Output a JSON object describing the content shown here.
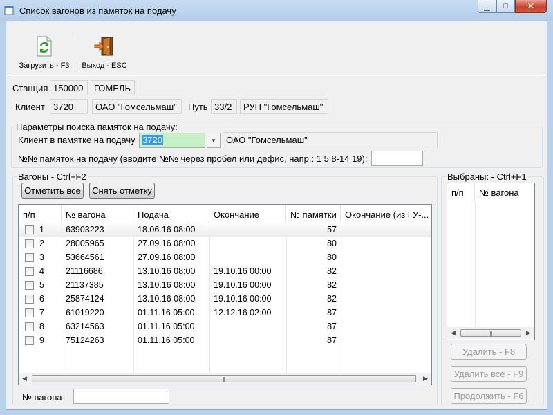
{
  "window": {
    "title": "Список вагонов из памяток на подачу",
    "min_glyph": "▁",
    "max_glyph": "□",
    "close_glyph": "✕"
  },
  "toolbar": {
    "load_label": "Загрузить - F3",
    "exit_label": "Выход - ESC"
  },
  "station": {
    "label": "Станция",
    "code": "150000",
    "name": "ГОМЕЛЬ"
  },
  "client": {
    "label": "Клиент",
    "code": "3720",
    "name": "ОАО \"Гомсельмаш\"",
    "track_label": "Путь",
    "track": "33/2",
    "track_owner": "РУП \"Гомсельмаш\""
  },
  "search": {
    "group_title": "Параметры поиска памяток на подачу:",
    "client_label": "Клиент в памятке на подачу",
    "client_value": "3720",
    "client_name": "ОАО \"Гомсельмаш\"",
    "memo_label": "№№ памяток на подачу (вводите №№ через пробел или дефис, напр.: 1 5 8-14 19):",
    "memo_value": ""
  },
  "wagons": {
    "group_title": "Вагоны - Ctrl+F2",
    "check_all": "Отметить все",
    "uncheck": "Снять отметку",
    "columns": [
      "п/п",
      "№ вагона",
      "Подача",
      "Окончание",
      "№ памятки",
      "Окончание (из ГУ-..."
    ],
    "rows": [
      {
        "n": "1",
        "wagon": "63903223",
        "supply": "18.06.16 08:00",
        "end": "",
        "memo": "57",
        "end_gu": ""
      },
      {
        "n": "2",
        "wagon": "28005965",
        "supply": "27.09.16 08:00",
        "end": "",
        "memo": "80",
        "end_gu": ""
      },
      {
        "n": "3",
        "wagon": "53664561",
        "supply": "27.09.16 08:00",
        "end": "",
        "memo": "80",
        "end_gu": ""
      },
      {
        "n": "4",
        "wagon": "21116686",
        "supply": "13.10.16 08:00",
        "end": "19.10.16 00:00",
        "memo": "82",
        "end_gu": ""
      },
      {
        "n": "5",
        "wagon": "21137385",
        "supply": "13.10.16 08:00",
        "end": "19.10.16 00:00",
        "memo": "82",
        "end_gu": ""
      },
      {
        "n": "6",
        "wagon": "25874124",
        "supply": "13.10.16 08:00",
        "end": "19.10.16 00:00",
        "memo": "82",
        "end_gu": ""
      },
      {
        "n": "7",
        "wagon": "61019220",
        "supply": "01.11.16 05:00",
        "end": "12.12.16 02:00",
        "memo": "87",
        "end_gu": ""
      },
      {
        "n": "8",
        "wagon": "63214563",
        "supply": "01.11.16 05:00",
        "end": "",
        "memo": "87",
        "end_gu": ""
      },
      {
        "n": "9",
        "wagon": "75124263",
        "supply": "01.11.16 05:00",
        "end": "",
        "memo": "87",
        "end_gu": ""
      }
    ],
    "wagon_no_label": "№ вагона",
    "wagon_no_value": ""
  },
  "selected": {
    "group_title": "Выбраны: - Ctrl+F1",
    "columns": [
      "п/п",
      "№ вагона"
    ],
    "delete_label": "Удалить - F8",
    "delete_all_label": "Удалить все - F9",
    "continue_label": "Продолжить - F6"
  },
  "colors": {
    "accent_selection": "#3399ff",
    "input_highlight": "#c6f0c6",
    "close_button": "#c7402c"
  }
}
